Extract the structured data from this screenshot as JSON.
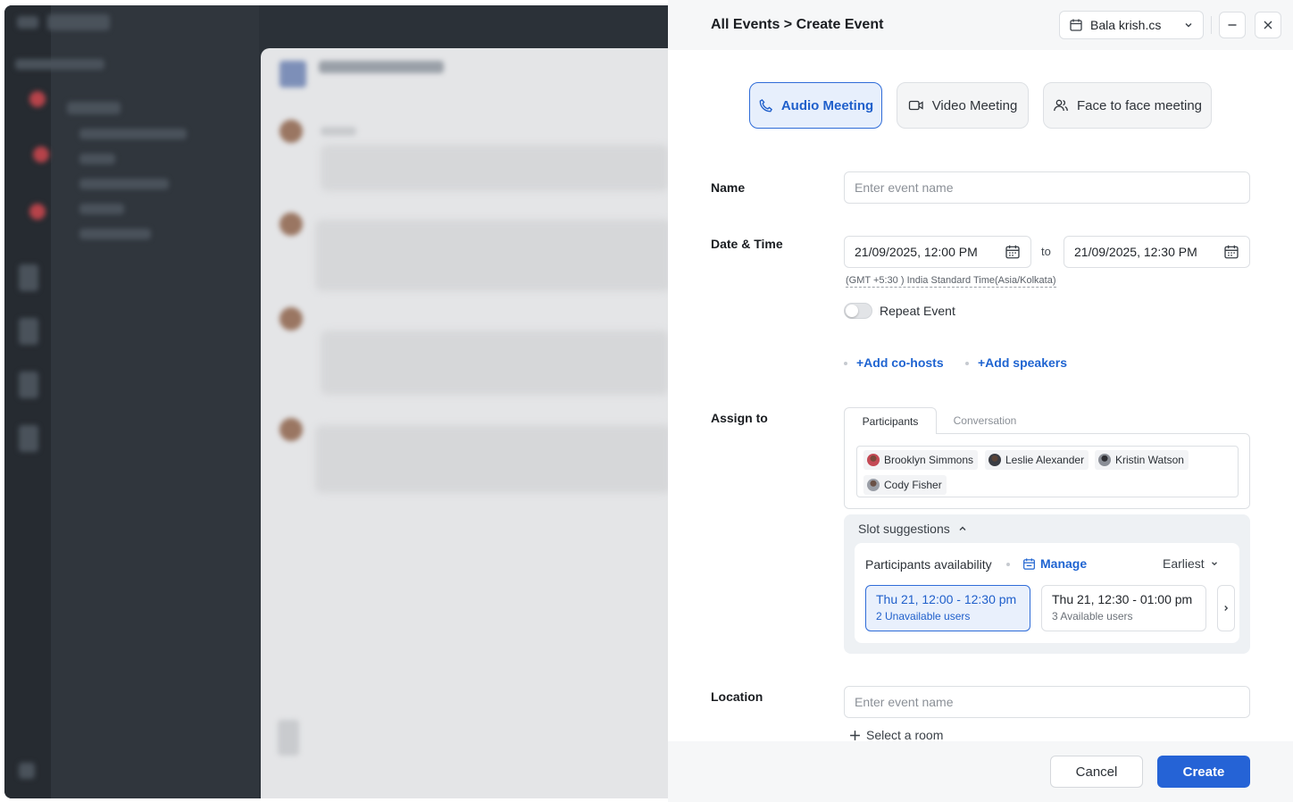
{
  "header": {
    "breadcrumb": "All Events > Create Event",
    "account_name": "Bala krish.cs"
  },
  "event_types": [
    {
      "label": "Audio Meeting",
      "icon": "phone-icon",
      "active": true
    },
    {
      "label": "Video Meeting",
      "icon": "video-icon",
      "active": false
    },
    {
      "label": "Face to face meeting",
      "icon": "people-icon",
      "active": false
    }
  ],
  "form": {
    "name_label": "Name",
    "name_placeholder": "Enter event name",
    "datetime_label": "Date & Time",
    "start": "21/09/2025, 12:00 PM",
    "to_label": "to",
    "end": "21/09/2025, 12:30 PM",
    "timezone": "(GMT +5:30 ) India Standard Time(Asia/Kolkata)",
    "repeat_label": "Repeat Event",
    "repeat_on": false,
    "add_cohosts": "+Add co-hosts",
    "add_speakers": "+Add speakers",
    "assign_label": "Assign to",
    "tabs": [
      "Participants",
      "Conversation"
    ],
    "participants": [
      "Brooklyn Simmons",
      "Leslie Alexander",
      "Kristin Watson",
      "Cody Fisher"
    ],
    "location_label": "Location",
    "location_placeholder": "Enter event name",
    "select_room": "Select a room"
  },
  "slots": {
    "title": "Slot suggestions",
    "availability_label": "Participants availability",
    "manage_label": "Manage",
    "sort_label": "Earliest",
    "items": [
      {
        "time": "Thu 21, 12:00 - 12:30 pm",
        "note": "2 Unavailable users",
        "selected": true
      },
      {
        "time": "Thu 21, 12:30 - 01:00 pm",
        "note": "3 Available users",
        "selected": false
      }
    ]
  },
  "footer": {
    "cancel_label": "Cancel",
    "create_label": "Create"
  },
  "colors": {
    "accent": "#2563d6",
    "link": "#1f64d1",
    "active_bg": "#e7effc"
  }
}
